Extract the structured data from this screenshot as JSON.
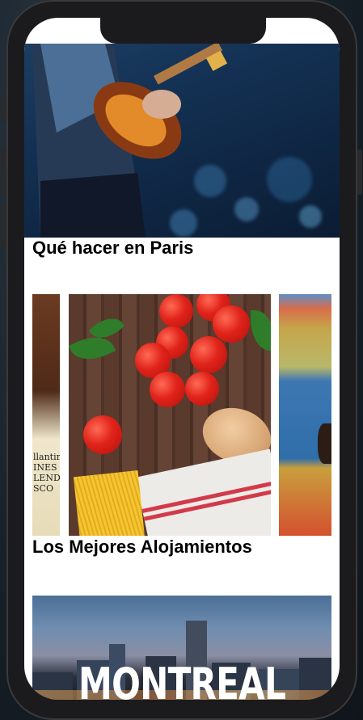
{
  "sections": {
    "things_to_do_title": "Qué hacer en Paris",
    "best_stays_title": "Los Mejores Alojamientos"
  },
  "hotel": {
    "city_label": "MONTREAL"
  },
  "carousel": {
    "left_card_text": "llantine INES LENDED SCO"
  }
}
